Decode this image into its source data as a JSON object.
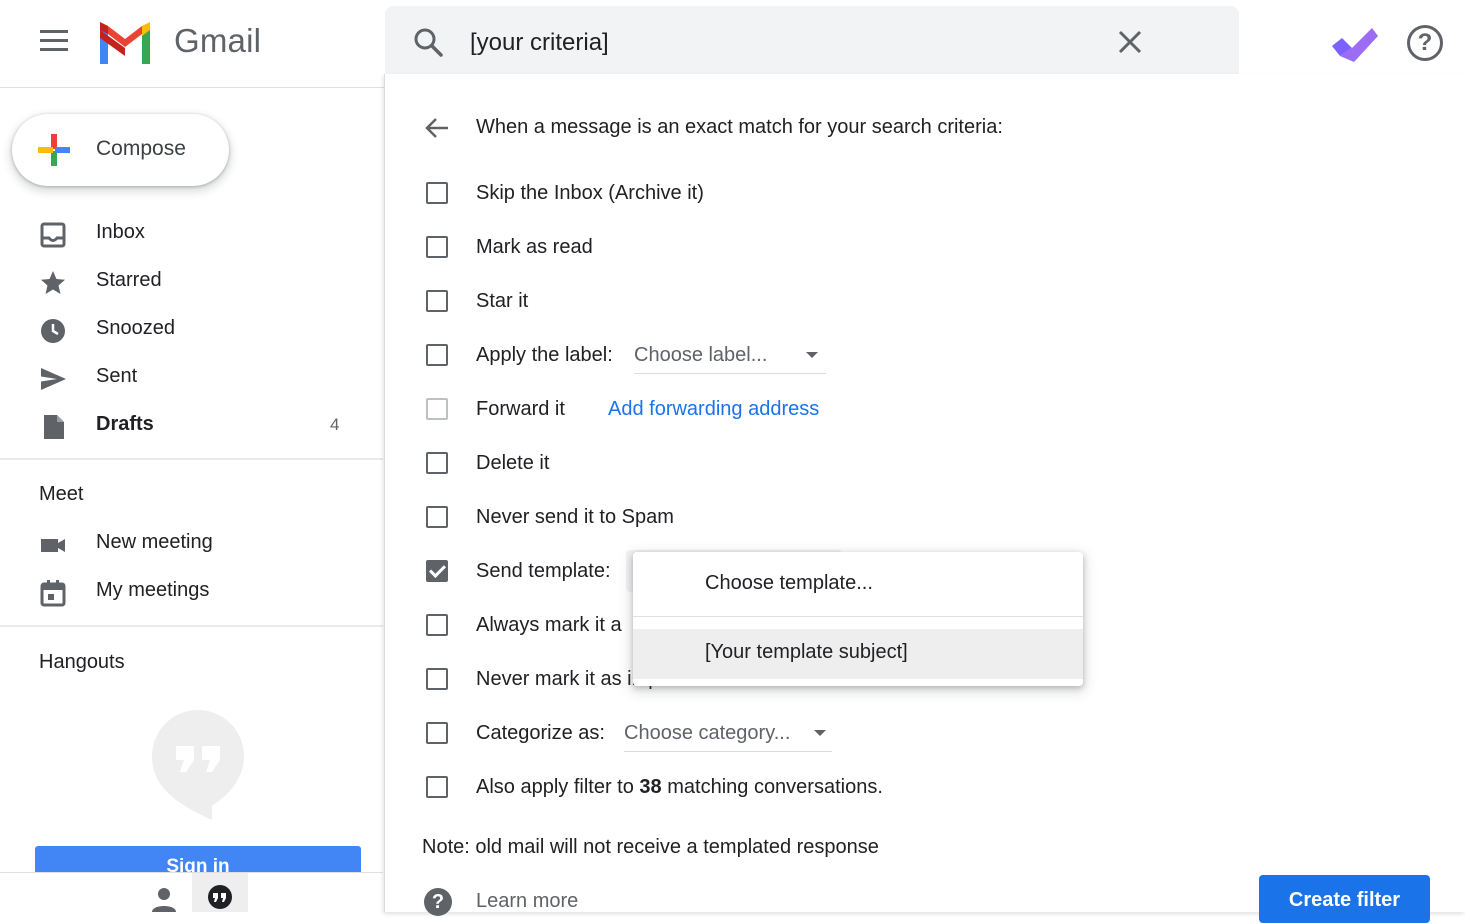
{
  "app": {
    "name": "Gmail"
  },
  "search": {
    "query": "[your criteria]"
  },
  "compose": {
    "label": "Compose"
  },
  "sidebar": {
    "items": [
      {
        "label": "Inbox",
        "icon": "inbox-icon"
      },
      {
        "label": "Starred",
        "icon": "star-icon"
      },
      {
        "label": "Snoozed",
        "icon": "clock-icon"
      },
      {
        "label": "Sent",
        "icon": "send-icon"
      },
      {
        "label": "Drafts",
        "icon": "draft-icon",
        "count": "4"
      }
    ],
    "meet": {
      "title": "Meet",
      "items": [
        {
          "label": "New meeting",
          "icon": "video-icon"
        },
        {
          "label": "My meetings",
          "icon": "calendar-icon"
        }
      ]
    },
    "hangouts": {
      "title": "Hangouts",
      "signin_label": "Sign in"
    }
  },
  "filter": {
    "heading": "When a message is an exact match for your search criteria:",
    "options": [
      {
        "label": "Skip the Inbox (Archive it)",
        "checked": false
      },
      {
        "label": "Mark as read",
        "checked": false
      },
      {
        "label": "Star it",
        "checked": false
      },
      {
        "label": "Apply the label:",
        "checked": false,
        "dropdown": "Choose label..."
      },
      {
        "label": "Forward it",
        "checked": false,
        "disabled": true,
        "link": "Add forwarding address"
      },
      {
        "label": "Delete it",
        "checked": false
      },
      {
        "label": "Never send it to Spam",
        "checked": false
      },
      {
        "label": "Send template:",
        "checked": true
      },
      {
        "label": "Always mark it a",
        "checked": false
      },
      {
        "label": "Never mark it as important",
        "checked": false
      },
      {
        "label": "Categorize as:",
        "checked": false,
        "dropdown": "Choose category..."
      },
      {
        "label_pre": "Also apply filter to ",
        "label_bold": "38",
        "label_post": " matching conversations.",
        "checked": false
      }
    ],
    "note": "Note: old mail will not receive a templated response",
    "learn_more": "Learn more",
    "create_button": "Create filter"
  },
  "template_menu": {
    "items": [
      {
        "label": "Choose template..."
      },
      {
        "label": "[Your template subject]",
        "highlighted": true
      }
    ]
  },
  "colors": {
    "accent": "#1a73e8",
    "signin": "#4285f4",
    "tasks": "#8a5cf6"
  }
}
